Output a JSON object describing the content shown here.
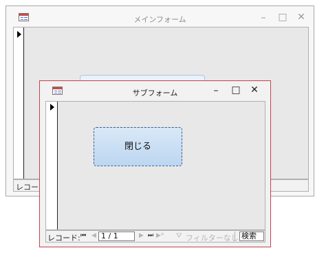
{
  "main_form": {
    "title": "メインフォーム",
    "controls": {
      "minimize": "–",
      "maximize": "□",
      "close": "✕"
    },
    "record_label": "レコード:"
  },
  "sub_form": {
    "title": "サブフォーム",
    "controls": {
      "minimize": "–",
      "maximize": "□",
      "close": "✕"
    },
    "close_button_label": "閉じる",
    "navigation": {
      "record_label": "レコード:",
      "first": "⏮",
      "prev": "◀",
      "position": "1 / 1",
      "next": "▶",
      "last": "⏭",
      "new_record": "▶*",
      "filter_icon": "funnel-x",
      "filter_label": "フィルターなし",
      "search": "検索"
    }
  },
  "colors": {
    "sub_form_border": "#c2414b",
    "button_fill": "#bcd6f1",
    "button_border": "#3c5f8a"
  }
}
